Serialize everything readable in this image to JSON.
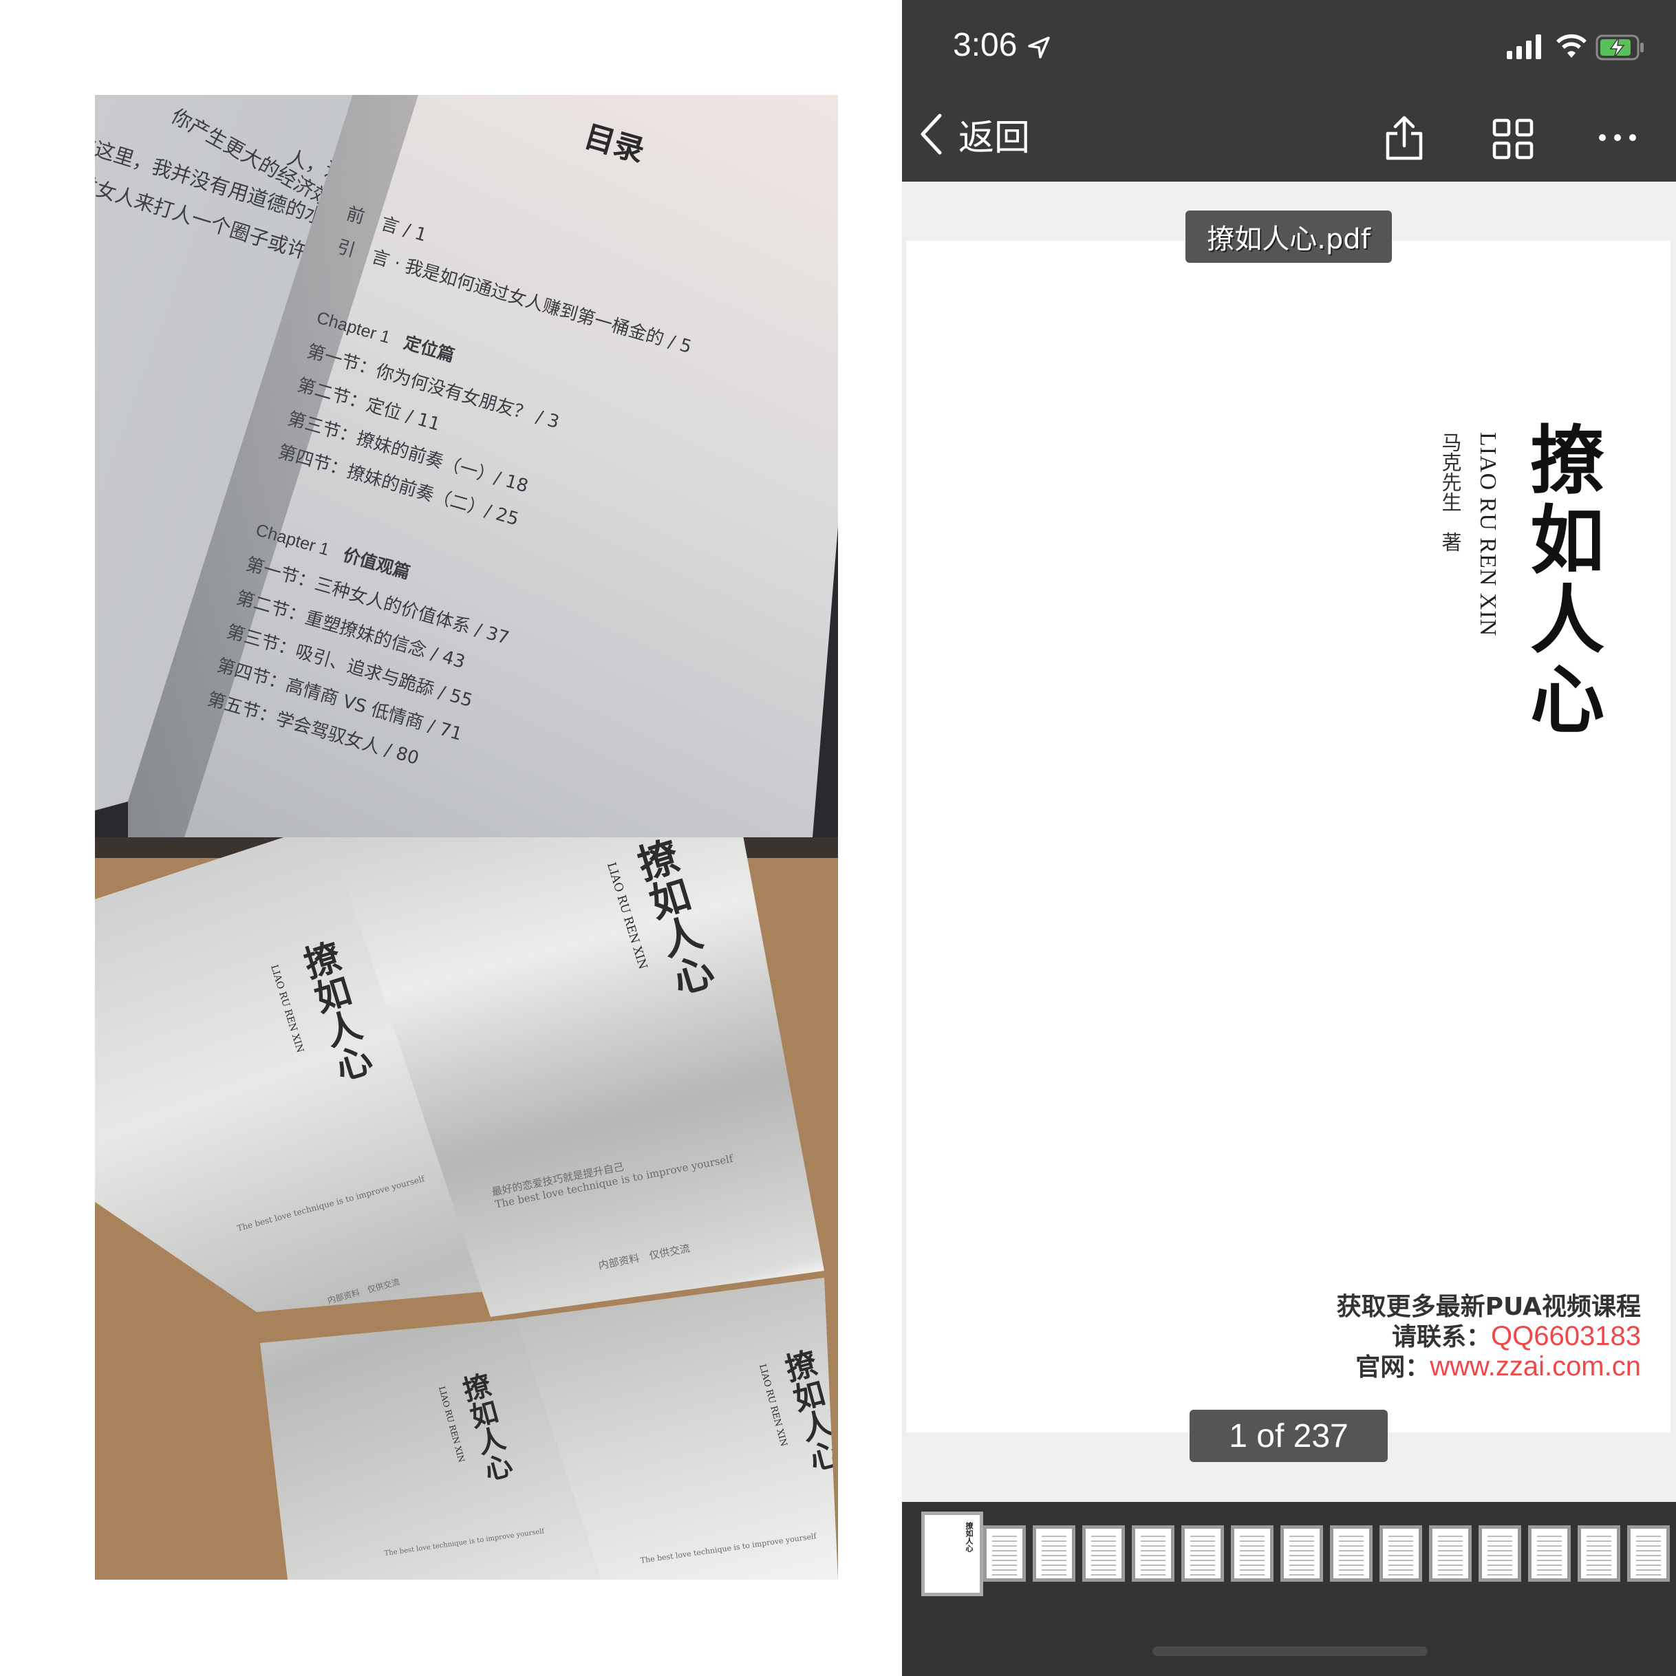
{
  "left_photos": {
    "toc_photo": {
      "title": "目录",
      "left_page_lines": [
        "人，还不如一",
        "你产生更大的经济效益",
        "在这里，我并没有用道德的水",
        "通过女人来打人一个圈子或许学"
      ],
      "entries": [
        {
          "text": "前　言 / 1"
        },
        {
          "text": "引　言 · 我是如何通过女人赚到第一桶金的 / 5"
        },
        {
          "chapter": "Chapter 1",
          "name": "定位篇"
        },
        {
          "text": "第一节：你为何没有女朋友？ / 3"
        },
        {
          "text": "第二节：定位 / 11"
        },
        {
          "text": "第三节：撩妹的前奏（一）/ 18"
        },
        {
          "text": "第四节：撩妹的前奏（二）/ 25"
        },
        {
          "chapter": "Chapter 1",
          "name": "价值观篇"
        },
        {
          "text": "第一节：三种女人的价值体系 / 37"
        },
        {
          "text": "第二节：重塑撩妹的信念 / 43"
        },
        {
          "text": "第三节：吸引、追求与跪舔 / 55"
        },
        {
          "text": "第四节：高情商 VS 低情商 / 71"
        },
        {
          "text": "第五节：学会驾驭女人 / 80"
        }
      ]
    },
    "books_photo": {
      "cover_title": "撩如人心",
      "cover_pinyin": "LIAO RU REN XIN",
      "tagline_cn": "最好的恋爱技巧就是提升自己",
      "tagline_en": "The best love technique is to improve yourself",
      "footer": "内部资料　仅供交流"
    }
  },
  "status_bar": {
    "time": "3:06",
    "location_icon": "location-arrow-icon",
    "signal_icon": "signal-icon",
    "wifi_icon": "wifi-icon",
    "battery_icon": "battery-charging-icon",
    "battery_color": "#5ac05a"
  },
  "nav": {
    "back_label": "返回",
    "share_icon": "share-icon",
    "grid_icon": "grid-icon",
    "more_icon": "more-icon"
  },
  "viewer": {
    "filename": "撩如人心.pdf",
    "page": {
      "title": "撩如人心",
      "pinyin": "LIAO RU REN XIN",
      "author": "马克先生　著",
      "ad_line1": "获取更多最新PUA视频课程",
      "ad_contact_label": "请联系：",
      "ad_contact_value": "QQ6603183",
      "ad_site_label": "官网：",
      "ad_site_value": "www.zzai.com.cn",
      "ad_accent": "#f04848"
    },
    "page_indicator": "1 of 237",
    "current_page": 1,
    "total_pages": 237
  }
}
